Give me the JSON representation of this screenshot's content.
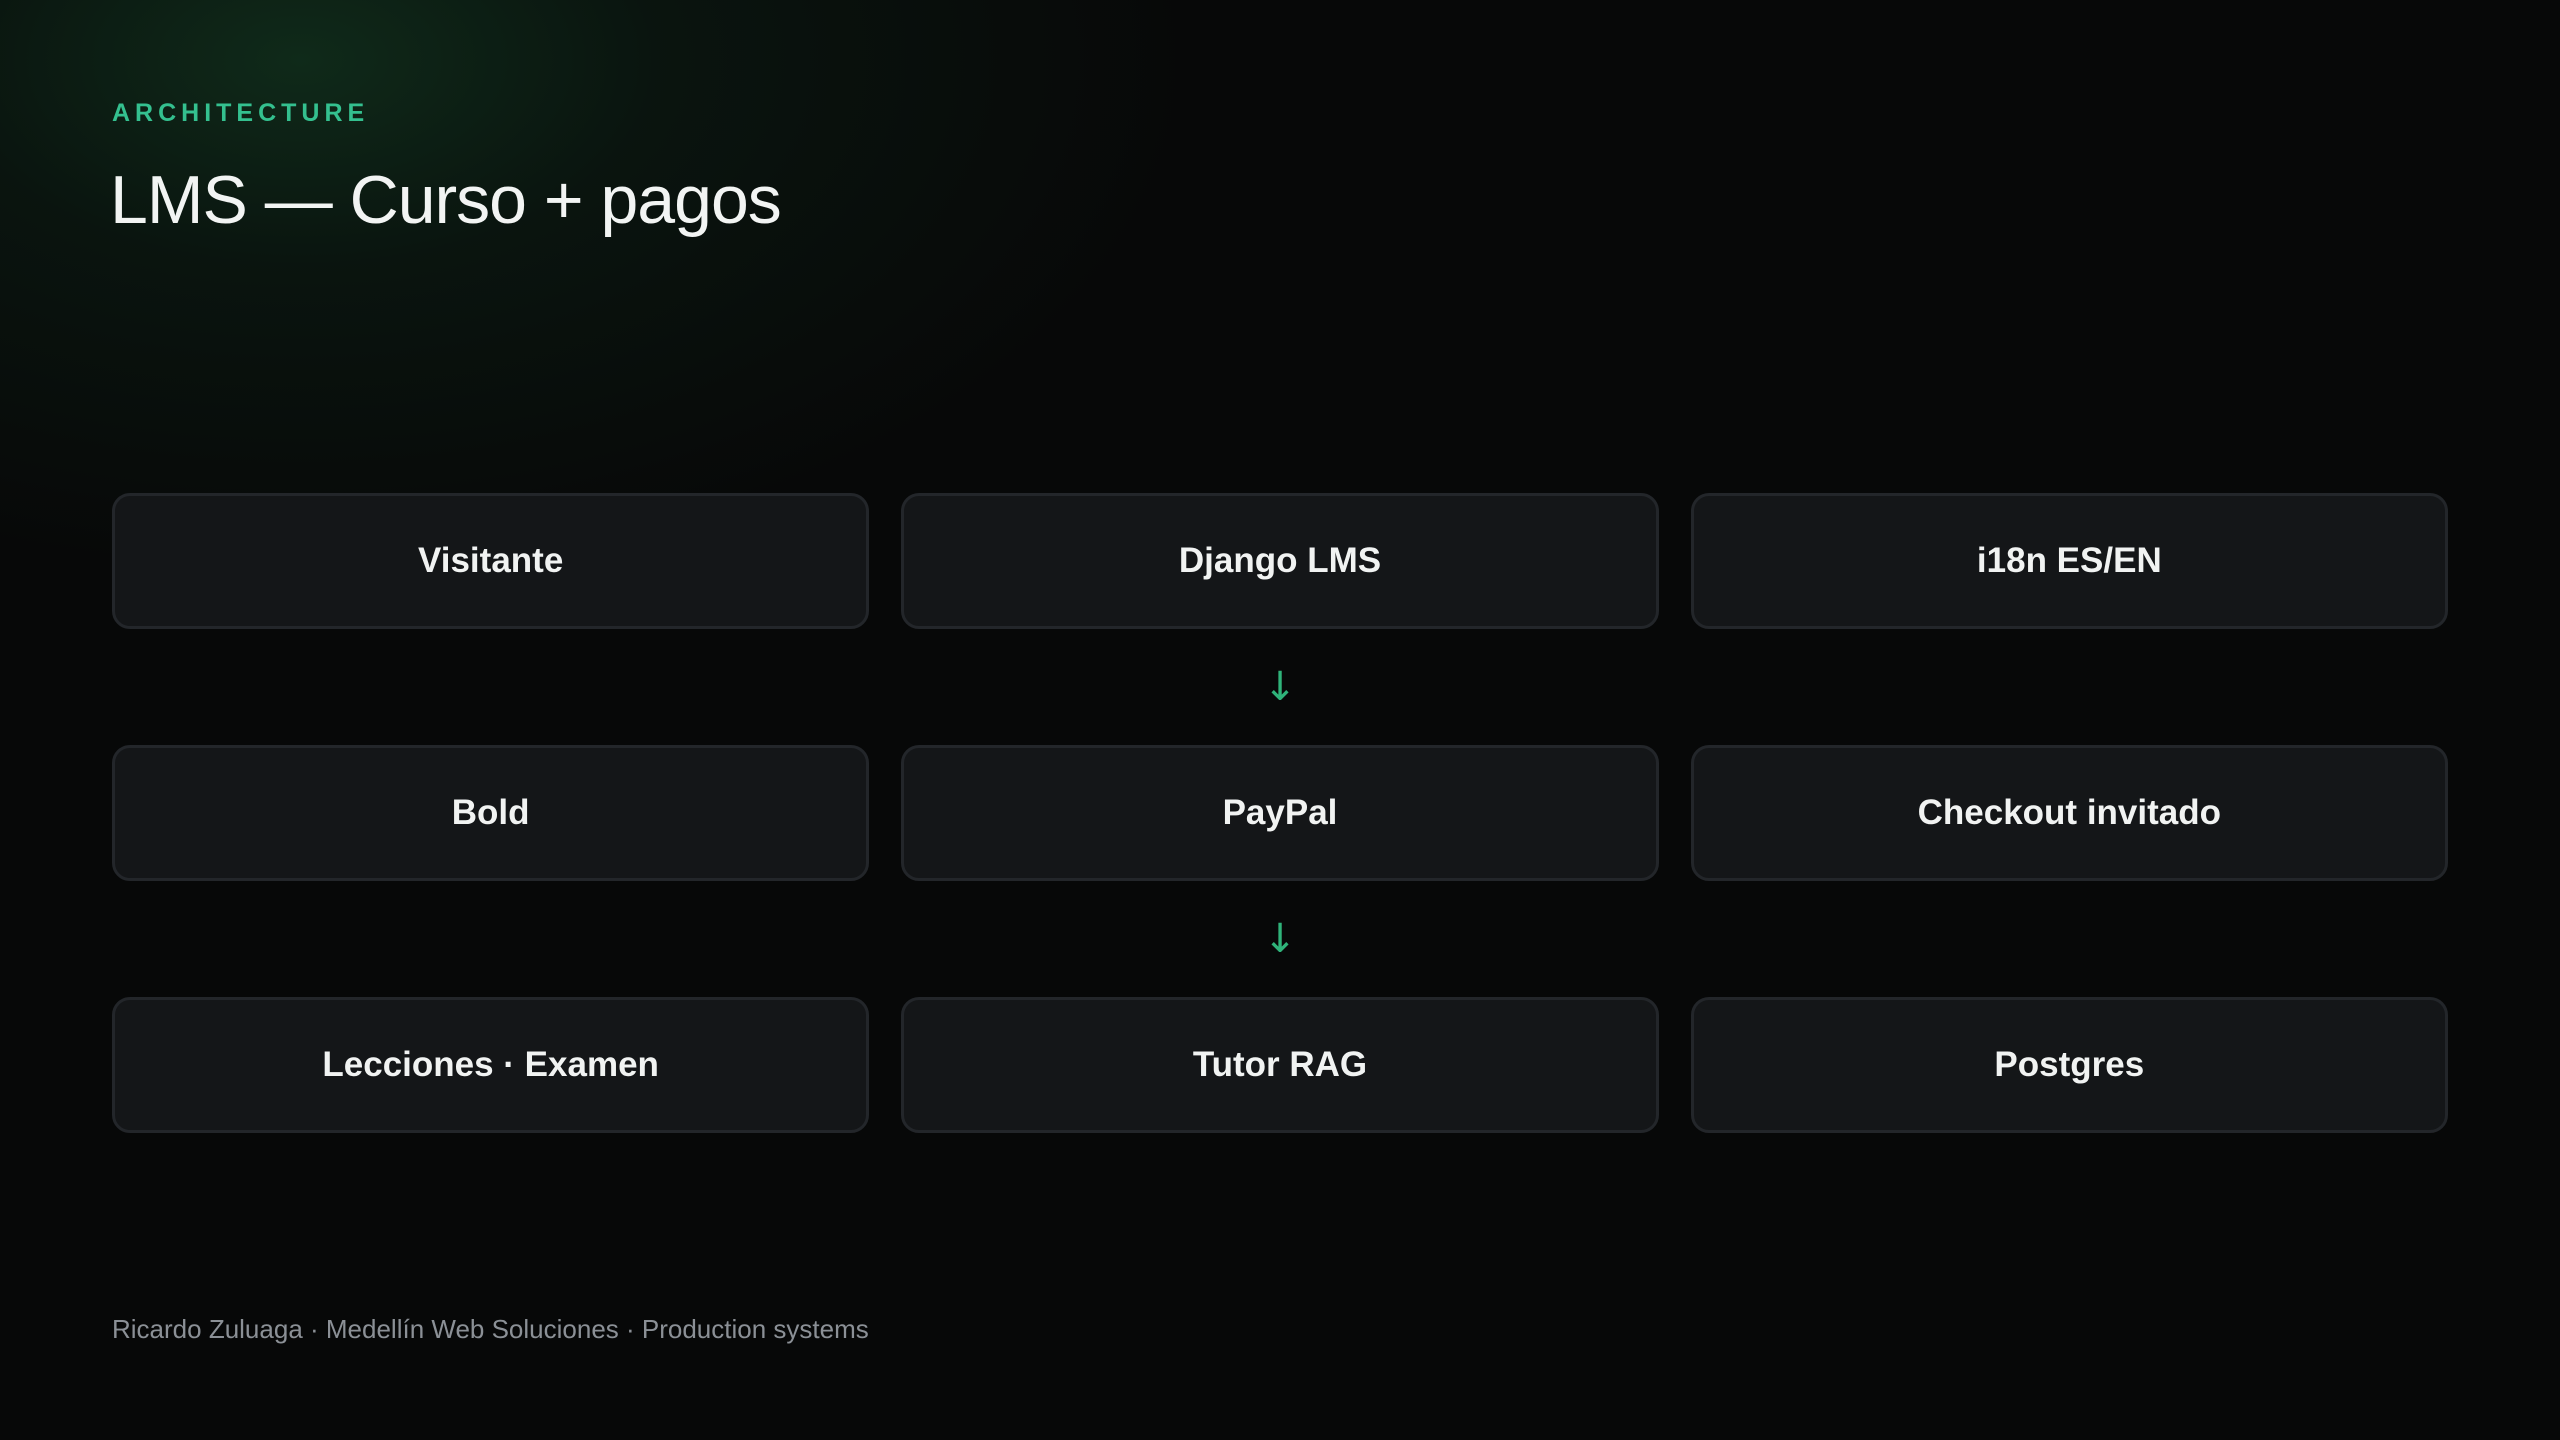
{
  "colors": {
    "background": "#070808",
    "accent": "#34c08f",
    "arrow": "#2fb37a",
    "box_fill": "#141618",
    "box_border": "#23262a",
    "text": "#f1f3f2",
    "muted": "#8b9096"
  },
  "header": {
    "eyebrow": "ARCHITECTURE",
    "title": "LMS — Curso + pagos"
  },
  "diagram": {
    "rows": [
      {
        "boxes": [
          "Visitante",
          "Django LMS",
          "i18n ES/EN"
        ]
      },
      {
        "boxes": [
          "Bold",
          "PayPal",
          "Checkout invitado"
        ]
      },
      {
        "boxes": [
          "Lecciones · Examen",
          "Tutor RAG",
          "Postgres"
        ]
      }
    ],
    "connectors": [
      "↓",
      "↓"
    ]
  },
  "footer": {
    "text": "Ricardo Zuluaga · Medellín Web Soluciones · Production systems"
  }
}
